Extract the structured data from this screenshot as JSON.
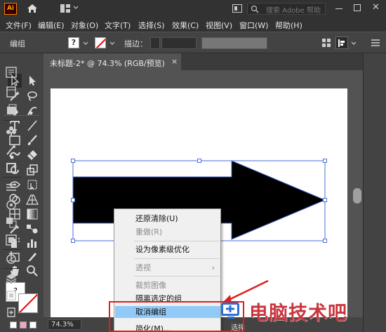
{
  "app": {
    "logo_text": "Ai",
    "search_placeholder": "搜索 Adobe 帮助"
  },
  "menu": [
    {
      "label": "文件(F)"
    },
    {
      "label": "编辑(E)"
    },
    {
      "label": "对象(O)"
    },
    {
      "label": "文字(T)"
    },
    {
      "label": "选择(S)"
    },
    {
      "label": "效果(C)"
    },
    {
      "label": "视图(V)"
    },
    {
      "label": "窗口(W)"
    },
    {
      "label": "帮助(H)"
    }
  ],
  "control_bar": {
    "selection_label": "编组",
    "fill_indicator": "?",
    "stroke_label": "描边："
  },
  "document": {
    "tab_label": "未标题-2* @ 74.3% (RGB/预览)",
    "close": "×"
  },
  "status": {
    "zoom": "74.3%",
    "tool": "选择"
  },
  "toolbar": {
    "fill_indicator": "?"
  },
  "context_menu": {
    "items": [
      {
        "label": "还原清除(U)",
        "enabled": true
      },
      {
        "label": "重做(R)",
        "enabled": false
      },
      {
        "label": "设为像素级优化",
        "enabled": true
      },
      {
        "label": "透视",
        "enabled": false,
        "submenu": true
      },
      {
        "label": "裁剪图像",
        "enabled": false
      },
      {
        "label": "隔离选定的组",
        "enabled": true
      },
      {
        "label": "取消编组",
        "enabled": true,
        "highlighted": true
      },
      {
        "label": "简化(M)...",
        "enabled": true
      }
    ],
    "submenu_arrow": "›"
  },
  "watermark": {
    "text": "电脑技术吧"
  },
  "colors": {
    "accent_highlight": "#91c9f7",
    "annotation_red": "#e21d1d",
    "selection_blue": "#4a6fd8",
    "watermark_red": "#c9363f"
  }
}
